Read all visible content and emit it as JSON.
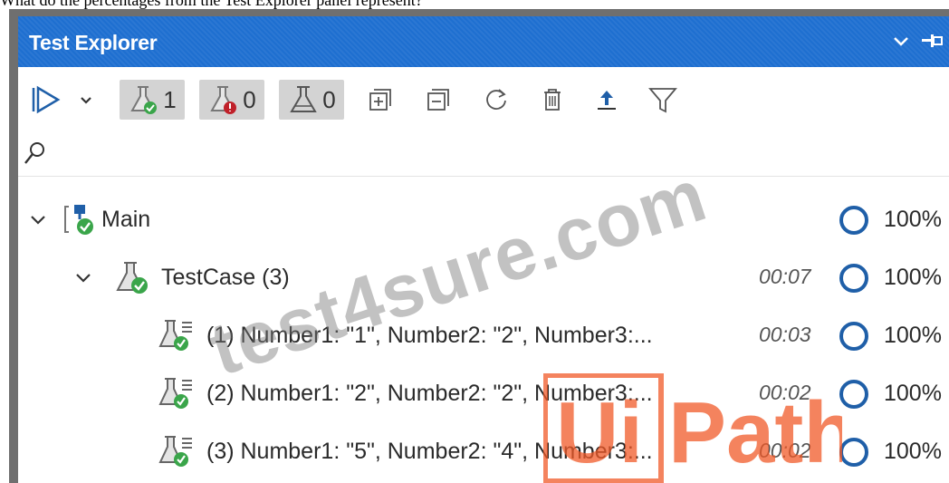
{
  "question": "What do the percentages from the Test Explorer panel represent?",
  "panel": {
    "title": "Test Explorer"
  },
  "toolbar": {
    "passed_count": "1",
    "failed_count": "0",
    "not_run_count": "0"
  },
  "tree": {
    "main": {
      "label": "Main",
      "percent": "100%"
    },
    "testcase": {
      "label": "TestCase (3)",
      "duration": "00:07",
      "percent": "100%"
    },
    "items": [
      {
        "label": "(1) Number1: \"1\", Number2: \"2\", Number3:...",
        "duration": "00:03",
        "percent": "100%"
      },
      {
        "label": "(2) Number1: \"2\", Number2: \"2\", Number3:...",
        "duration": "00:02",
        "percent": "100%"
      },
      {
        "label": "(3) Number1: \"5\", Number2: \"4\", Number3:...",
        "duration": "00:02",
        "percent": "100%"
      }
    ]
  },
  "watermark": {
    "site": "test4sure.com",
    "brand_left": "Ui",
    "brand_right": "Path"
  },
  "colors": {
    "title_bar": "#1e6fd0",
    "ring": "#1f5fa8",
    "pass_green": "#3aa54a",
    "fail_red": "#c0212a",
    "brand_orange": "#f05a28"
  }
}
